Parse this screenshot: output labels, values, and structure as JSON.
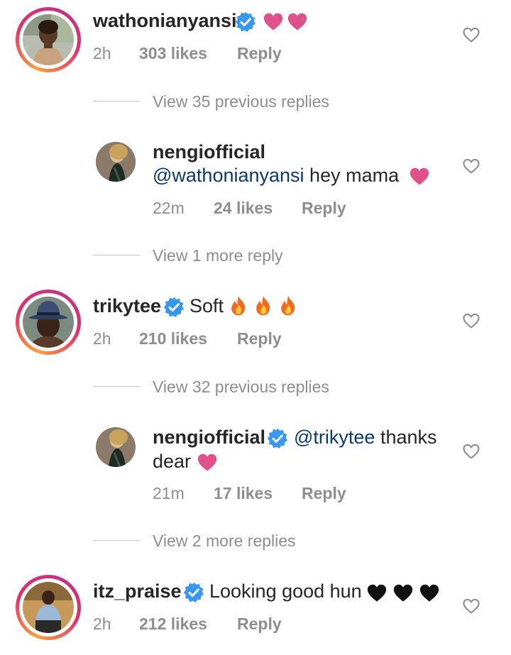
{
  "colors": {
    "text": "#262626",
    "secondary": "#8e8e8e",
    "mention": "#0b3a6e",
    "verified": "#3897f0",
    "pink_heart": "#e0508a",
    "fire": "#f26a1b"
  },
  "comments": [
    {
      "username": "wathonianyansi",
      "verified": true,
      "text": "",
      "emoji": [
        "pink-heart",
        "pink-heart"
      ],
      "time": "2h",
      "likes": "303 likes",
      "reply": "Reply",
      "view_replies": "View 35 previous replies"
    },
    {
      "username": "nengiofficial",
      "verified": false,
      "mention": "@wathonianyansi",
      "text": " hey mama",
      "emoji": [
        "pink-heart"
      ],
      "time": "22m",
      "likes": "24 likes",
      "reply": "Reply",
      "view_replies": "View 1 more reply"
    },
    {
      "username": "trikytee",
      "verified": true,
      "text": "Soft",
      "emoji": [
        "fire",
        "fire",
        "fire"
      ],
      "time": "2h",
      "likes": "210 likes",
      "reply": "Reply",
      "view_replies": "View 32 previous replies"
    },
    {
      "username": "nengiofficial",
      "verified": true,
      "mention": "@trikytee",
      "text": " thanks",
      "text_line2": "dear",
      "emoji": [
        "pink-heart"
      ],
      "time": "21m",
      "likes": "17 likes",
      "reply": "Reply",
      "view_replies": "View 2 more replies"
    },
    {
      "username": "itz_praise",
      "verified": true,
      "text": "Looking good hun",
      "emoji": [
        "black-heart",
        "black-heart",
        "black-heart"
      ],
      "time": "2h",
      "likes": "212 likes",
      "reply": "Reply"
    }
  ]
}
